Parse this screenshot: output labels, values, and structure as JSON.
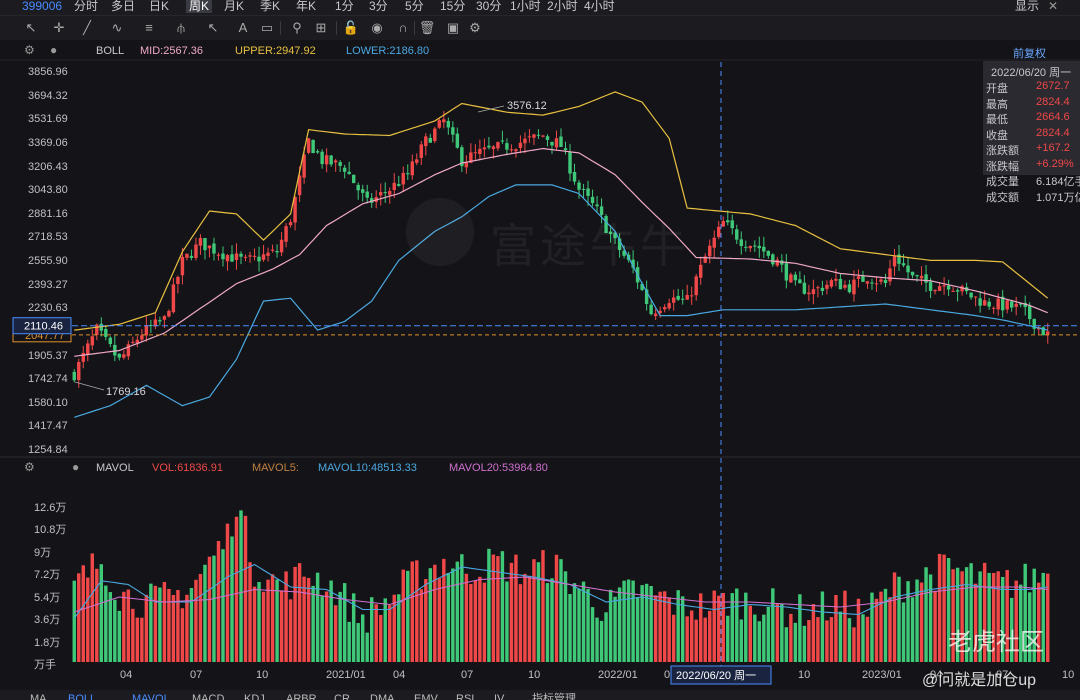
{
  "topbar": {
    "symbol": "399006",
    "periods": [
      "分时",
      "多日",
      "日K",
      "周K",
      "月K",
      "季K",
      "年K",
      "1分",
      "3分",
      "5分",
      "15分",
      "30分",
      "1小时",
      "2小时",
      "4小时"
    ],
    "active_period": "周K",
    "display_label": "显示",
    "close_symbol": "✕"
  },
  "toolbar": {
    "icons": [
      "cursor-icon",
      "crosshair-icon",
      "line-draw-icon",
      "wave-icon",
      "fib-icon",
      "pitchfork-icon",
      "arrow-icon",
      "text-icon",
      "comment-icon",
      "magnifier-icon",
      "ruler-icon",
      "lock-icon",
      "eye-icon",
      "magnet-icon",
      "trash-icon",
      "layers-icon",
      "settings-icon"
    ]
  },
  "boll": {
    "name": "BOLL",
    "mid_label": "MID:2567.36",
    "upper_label": "UPPER:2947.92",
    "lower_label": "LOWER:2186.80",
    "mid_color": "#f0a8c8",
    "upper_color": "#e8c040",
    "lower_color": "#4aa8e0",
    "adjust_label": "前复权"
  },
  "info": {
    "date": "2022/06/20 周一",
    "rows": [
      {
        "k": "开盘",
        "v": "2672.7",
        "c": "#f04848"
      },
      {
        "k": "最高",
        "v": "2824.4",
        "c": "#f04848"
      },
      {
        "k": "最低",
        "v": "2664.6",
        "c": "#f04848"
      },
      {
        "k": "收盘",
        "v": "2824.4",
        "c": "#f04848"
      },
      {
        "k": "涨跌额",
        "v": "+167.2",
        "c": "#f04848"
      },
      {
        "k": "涨跌幅",
        "v": "+6.29%",
        "c": "#f04848"
      },
      {
        "k": "成交量",
        "v": "6.184亿手",
        "c": "#c8c8cc"
      },
      {
        "k": "成交额",
        "v": "1.071万亿",
        "c": "#c8c8cc"
      }
    ]
  },
  "mavol": {
    "name": "MAVOL",
    "vol_label": "VOL:61836.91",
    "ma5_label": "MAVOL5:",
    "ma10_label": "MAVOL10:48513.33",
    "ma20_label": "MAVOL20:53984.80"
  },
  "watermark": "富途牛牛",
  "community_watermark": "老虎社区",
  "author_watermark": "@问就是加仓up",
  "bottombar": [
    "MA",
    "BOLL",
    "MAVOL",
    "MACD",
    "KDJ",
    "ARBR",
    "CR",
    "DMA",
    "EMV",
    "RSI",
    "IV",
    "指标管理"
  ],
  "chart_data": {
    "type": "candlestick",
    "price_axis": {
      "ticks": [
        3856.96,
        3694.32,
        3531.69,
        3369.06,
        3206.43,
        3043.8,
        2881.16,
        2718.53,
        2555.9,
        2393.27,
        2230.63,
        2068.0,
        1905.37,
        1742.74,
        1580.1,
        1417.47,
        1254.84
      ],
      "tick_labels": [
        "3856.96",
        "3694.32",
        "3531.69",
        "3369.06",
        "3206.43",
        "3043.80",
        "2881.16",
        "2718.53",
        "2555.90",
        "2393.27",
        "2230.63",
        "",
        "1905.37",
        "1742.74",
        "1580.10",
        "1417.47",
        "1254.84"
      ],
      "range": [
        1254.84,
        3856.96
      ]
    },
    "current_price_label": "2110.46",
    "current_price": 2110.46,
    "ref_price_label": "2047.77",
    "ref_price": 2047.77,
    "max_annotation": {
      "label": "3576.12",
      "value": 3576.12
    },
    "min_annotation": {
      "label": "1769.16",
      "value": 1769.16
    },
    "volume_axis": {
      "tick_labels": [
        "12.6万",
        "10.8万",
        "9万",
        "7.2万",
        "5.4万",
        "3.6万",
        "1.8万",
        "万手"
      ],
      "ticks": [
        126000,
        108000,
        90000,
        72000,
        54000,
        36000,
        18000,
        0
      ],
      "range": [
        0,
        140000
      ]
    },
    "x_labels": [
      "04",
      "07",
      "10",
      "2021/01",
      "04",
      "07",
      "10",
      "2022/01",
      "0",
      "10",
      "2023/01",
      "04",
      "07",
      "10"
    ],
    "crosshair_date": "2022/06/20 周一",
    "price_keypoints": [
      [
        0,
        1780
      ],
      [
        5,
        2080
      ],
      [
        10,
        1870
      ],
      [
        15,
        2060
      ],
      [
        20,
        2150
      ],
      [
        24,
        2550
      ],
      [
        28,
        2680
      ],
      [
        32,
        2620
      ],
      [
        38,
        2550
      ],
      [
        45,
        2620
      ],
      [
        48,
        2850
      ],
      [
        52,
        3380
      ],
      [
        55,
        3250
      ],
      [
        60,
        3200
      ],
      [
        65,
        2950
      ],
      [
        70,
        3050
      ],
      [
        74,
        3150
      ],
      [
        78,
        3380
      ],
      [
        82,
        3520
      ],
      [
        86,
        3250
      ],
      [
        90,
        3300
      ],
      [
        96,
        3350
      ],
      [
        100,
        3380
      ],
      [
        104,
        3420
      ],
      [
        108,
        3350
      ],
      [
        112,
        3050
      ],
      [
        116,
        2900
      ],
      [
        120,
        2680
      ],
      [
        124,
        2500
      ],
      [
        128,
        2200
      ],
      [
        132,
        2300
      ],
      [
        136,
        2280
      ],
      [
        140,
        2580
      ],
      [
        144,
        2820
      ],
      [
        148,
        2700
      ],
      [
        152,
        2650
      ],
      [
        156,
        2550
      ],
      [
        160,
        2380
      ],
      [
        164,
        2350
      ],
      [
        168,
        2410
      ],
      [
        172,
        2380
      ],
      [
        176,
        2450
      ],
      [
        180,
        2400
      ],
      [
        182,
        2600
      ],
      [
        186,
        2440
      ],
      [
        190,
        2390
      ],
      [
        194,
        2400
      ],
      [
        198,
        2330
      ],
      [
        202,
        2270
      ],
      [
        206,
        2250
      ],
      [
        210,
        2230
      ],
      [
        214,
        2100
      ],
      [
        216,
        2047
      ]
    ],
    "upper_keypoints": [
      [
        0,
        2080
      ],
      [
        10,
        2120
      ],
      [
        18,
        2200
      ],
      [
        24,
        2620
      ],
      [
        30,
        2900
      ],
      [
        36,
        2880
      ],
      [
        42,
        2700
      ],
      [
        48,
        2880
      ],
      [
        52,
        3460
      ],
      [
        60,
        3430
      ],
      [
        70,
        3420
      ],
      [
        80,
        3520
      ],
      [
        86,
        3640
      ],
      [
        96,
        3580
      ],
      [
        104,
        3560
      ],
      [
        112,
        3620
      ],
      [
        120,
        3720
      ],
      [
        126,
        3650
      ],
      [
        132,
        3400
      ],
      [
        136,
        2920
      ],
      [
        150,
        2880
      ],
      [
        160,
        2800
      ],
      [
        170,
        2640
      ],
      [
        180,
        2600
      ],
      [
        190,
        2560
      ],
      [
        200,
        2560
      ],
      [
        206,
        2550
      ],
      [
        212,
        2400
      ],
      [
        216,
        2300
      ]
    ],
    "mid_keypoints": [
      [
        0,
        1900
      ],
      [
        10,
        1940
      ],
      [
        20,
        2060
      ],
      [
        28,
        2230
      ],
      [
        36,
        2400
      ],
      [
        44,
        2500
      ],
      [
        50,
        2600
      ],
      [
        56,
        2800
      ],
      [
        64,
        2950
      ],
      [
        72,
        3020
      ],
      [
        80,
        3150
      ],
      [
        86,
        3230
      ],
      [
        96,
        3290
      ],
      [
        104,
        3330
      ],
      [
        112,
        3300
      ],
      [
        120,
        3150
      ],
      [
        126,
        2960
      ],
      [
        132,
        2780
      ],
      [
        138,
        2580
      ],
      [
        150,
        2570
      ],
      [
        160,
        2540
      ],
      [
        170,
        2470
      ],
      [
        180,
        2440
      ],
      [
        190,
        2420
      ],
      [
        200,
        2350
      ],
      [
        206,
        2300
      ],
      [
        212,
        2250
      ],
      [
        216,
        2200
      ]
    ],
    "lower_keypoints": [
      [
        0,
        1480
      ],
      [
        8,
        1560
      ],
      [
        16,
        1700
      ],
      [
        24,
        1560
      ],
      [
        30,
        1620
      ],
      [
        36,
        1880
      ],
      [
        42,
        2280
      ],
      [
        48,
        2300
      ],
      [
        54,
        2080
      ],
      [
        60,
        2140
      ],
      [
        66,
        2280
      ],
      [
        72,
        2560
      ],
      [
        80,
        2760
      ],
      [
        86,
        2860
      ],
      [
        92,
        3000
      ],
      [
        98,
        3080
      ],
      [
        106,
        3080
      ],
      [
        112,
        3020
      ],
      [
        120,
        2760
      ],
      [
        126,
        2400
      ],
      [
        130,
        2180
      ],
      [
        136,
        2180
      ],
      [
        144,
        2220
      ],
      [
        152,
        2220
      ],
      [
        160,
        2220
      ],
      [
        170,
        2240
      ],
      [
        180,
        2260
      ],
      [
        190,
        2220
      ],
      [
        200,
        2180
      ],
      [
        206,
        2150
      ],
      [
        212,
        2110
      ],
      [
        216,
        2080
      ]
    ],
    "volume_keypoints": [
      [
        0,
        60000
      ],
      [
        6,
        82000
      ],
      [
        10,
        55000
      ],
      [
        16,
        48000
      ],
      [
        22,
        52000
      ],
      [
        26,
        60000
      ],
      [
        30,
        80000
      ],
      [
        34,
        100000
      ],
      [
        36,
        130000
      ],
      [
        40,
        75000
      ],
      [
        46,
        60000
      ],
      [
        52,
        72000
      ],
      [
        58,
        58000
      ],
      [
        64,
        35000
      ],
      [
        70,
        50000
      ],
      [
        76,
        70000
      ],
      [
        82,
        80000
      ],
      [
        88,
        74000
      ],
      [
        94,
        80000
      ],
      [
        100,
        72000
      ],
      [
        106,
        78000
      ],
      [
        112,
        60000
      ],
      [
        118,
        42000
      ],
      [
        124,
        58000
      ],
      [
        130,
        52000
      ],
      [
        134,
        46000
      ],
      [
        140,
        44000
      ],
      [
        146,
        50000
      ],
      [
        152,
        47000
      ],
      [
        160,
        40000
      ],
      [
        168,
        44000
      ],
      [
        176,
        40000
      ],
      [
        182,
        60000
      ],
      [
        188,
        68000
      ],
      [
        194,
        75000
      ],
      [
        200,
        68000
      ],
      [
        206,
        62000
      ],
      [
        212,
        66000
      ],
      [
        216,
        72000
      ]
    ],
    "ma10_keypoints": [
      [
        0,
        35000
      ],
      [
        6,
        65000
      ],
      [
        12,
        62000
      ],
      [
        18,
        48000
      ],
      [
        26,
        48000
      ],
      [
        34,
        68000
      ],
      [
        40,
        78000
      ],
      [
        48,
        60000
      ],
      [
        56,
        58000
      ],
      [
        64,
        42000
      ],
      [
        70,
        42000
      ],
      [
        78,
        62000
      ],
      [
        86,
        76000
      ],
      [
        94,
        72000
      ],
      [
        102,
        68000
      ],
      [
        110,
        62000
      ],
      [
        118,
        48000
      ],
      [
        126,
        52000
      ],
      [
        134,
        46000
      ],
      [
        142,
        42000
      ],
      [
        150,
        46000
      ],
      [
        158,
        44000
      ],
      [
        166,
        40000
      ],
      [
        174,
        38000
      ],
      [
        182,
        52000
      ],
      [
        190,
        58000
      ],
      [
        198,
        62000
      ],
      [
        206,
        58000
      ],
      [
        212,
        58000
      ],
      [
        216,
        60000
      ]
    ],
    "ma20_keypoints": [
      [
        0,
        40000
      ],
      [
        10,
        52000
      ],
      [
        20,
        48000
      ],
      [
        30,
        50000
      ],
      [
        40,
        58000
      ],
      [
        50,
        56000
      ],
      [
        60,
        50000
      ],
      [
        70,
        46000
      ],
      [
        80,
        58000
      ],
      [
        90,
        66000
      ],
      [
        100,
        68000
      ],
      [
        110,
        62000
      ],
      [
        120,
        56000
      ],
      [
        130,
        52000
      ],
      [
        140,
        48000
      ],
      [
        150,
        48000
      ],
      [
        160,
        46000
      ],
      [
        170,
        44000
      ],
      [
        180,
        48000
      ],
      [
        190,
        56000
      ],
      [
        200,
        60000
      ],
      [
        210,
        60000
      ],
      [
        216,
        58000
      ]
    ],
    "bar_count": 217,
    "up_color": "#f04848",
    "down_color": "#3ec878"
  }
}
